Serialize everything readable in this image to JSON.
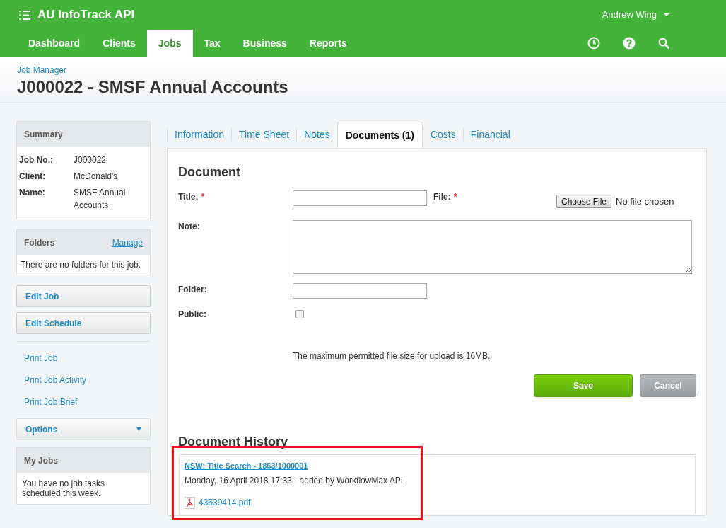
{
  "app": {
    "title": "AU InfoTrack API",
    "user": "Andrew Wing"
  },
  "nav": [
    {
      "label": "Dashboard",
      "selected": false
    },
    {
      "label": "Clients",
      "selected": false
    },
    {
      "label": "Jobs",
      "selected": true
    },
    {
      "label": "Tax",
      "selected": false
    },
    {
      "label": "Business",
      "selected": false
    },
    {
      "label": "Reports",
      "selected": false
    }
  ],
  "header": {
    "breadcrumb": "Job Manager",
    "title": "J000022 - SMSF Annual Accounts"
  },
  "sidebar": {
    "summary": {
      "title": "Summary",
      "rows": [
        {
          "label": "Job No.:",
          "value": "J000022"
        },
        {
          "label": "Client:",
          "value": "McDonald's"
        },
        {
          "label": "Name:",
          "value": "SMSF Annual Accounts"
        }
      ]
    },
    "folders": {
      "title": "Folders",
      "link": "Manage",
      "text": "There are no folders for this job."
    },
    "buttons": [
      "Edit Job",
      "Edit Schedule"
    ],
    "links": [
      "Print Job",
      "Print Job Activity",
      "Print Job Brief"
    ],
    "options": "Options",
    "my_jobs": {
      "title": "My Jobs",
      "text": "You have no job tasks scheduled this week."
    }
  },
  "tabs": [
    {
      "label": "Information",
      "selected": false
    },
    {
      "label": "Time Sheet",
      "selected": false
    },
    {
      "label": "Notes",
      "selected": false
    },
    {
      "label": "Documents (1)",
      "selected": true
    },
    {
      "label": "Costs",
      "selected": false
    },
    {
      "label": "Financial",
      "selected": false
    }
  ],
  "form": {
    "heading": "Document",
    "title_label": "Title:",
    "required_mark": "*",
    "file_label": "File:",
    "file_button": "Choose File",
    "file_status": "No file chosen",
    "note_label": "Note:",
    "folder_label": "Folder:",
    "public_label": "Public:",
    "public_checked": false,
    "size_note": "The maximum permitted file size for upload is 16MB.",
    "save": "Save",
    "cancel": "Cancel"
  },
  "history": {
    "heading": "Document History",
    "items": [
      {
        "title": "NSW: Title Search - 1863/1000001",
        "meta": "Monday, 16 April 2018 17:33 - added by WorkflowMax API",
        "file": "43539414.pdf",
        "highlighted": true
      }
    ]
  }
}
